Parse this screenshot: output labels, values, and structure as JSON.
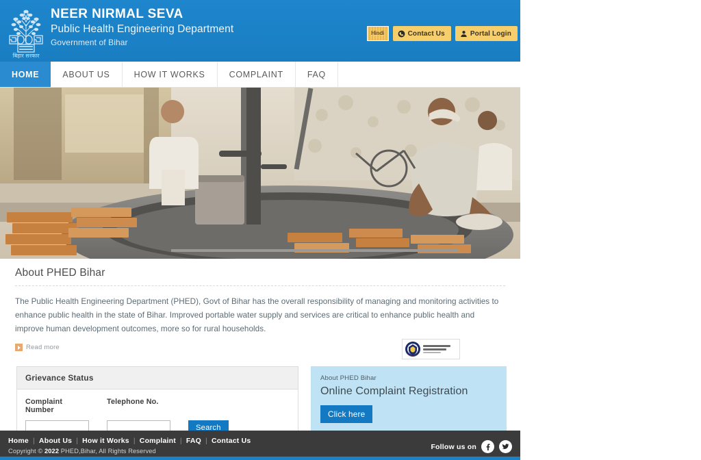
{
  "header": {
    "emblem_name": "bihar-government-emblem",
    "emblem_caption": "बिहार सरकार",
    "title": "NEER NIRMAL SEVA",
    "subtitle": "Public Health Engineering Department",
    "subtitle2": "Government of Bihar",
    "buttons": {
      "language_label": "Hindi",
      "contact_label": "Contact Us",
      "contact_icon": "phone-icon",
      "login_label": "Portal Login",
      "login_icon": "user-icon"
    }
  },
  "nav": {
    "items": [
      {
        "label": "HOME",
        "active": true
      },
      {
        "label": "ABOUT US",
        "active": false
      },
      {
        "label": "HOW IT WORKS",
        "active": false
      },
      {
        "label": "COMPLAINT",
        "active": false
      },
      {
        "label": "FAQ",
        "active": false
      }
    ]
  },
  "hero": {
    "alt": "Workers constructing a hand pump platform with bricks"
  },
  "about": {
    "heading": "About PHED Bihar",
    "body": "The Public Health Engineering Department (PHED), Govt of Bihar has the overall responsibility of managing and monitoring activities to enhance public health in the state of Bihar. Improved portable water supply and services are critical to enhance public health and improve human development outcomes, more so for rural households.",
    "read_more": "Read more",
    "read_more_icon": "play-arrow-icon",
    "badge_name": "partner-logo-badge"
  },
  "grievance": {
    "title": "Grievance Status",
    "complaint_label": "Complaint Number",
    "complaint_value": "",
    "complaint_placeholder": "",
    "telephone_label": "Telephone No.",
    "telephone_value": "",
    "telephone_placeholder": "",
    "search_label": "Search"
  },
  "registration": {
    "eyebrow": "About PHED Bihar",
    "title": "Online Complaint Registration",
    "button_label": "Click here"
  },
  "footer": {
    "links": [
      "Home",
      "About Us",
      "How it Works",
      "Complaint",
      "FAQ",
      "Contact Us"
    ],
    "separator": "|",
    "copyright_prefix": "Copyright © ",
    "copyright_year": "2022",
    "copyright_suffix": " PHED,Bihar, All Rights Reserved",
    "follow_label": "Follow us on",
    "social": [
      "facebook-icon",
      "twitter-icon"
    ]
  },
  "colors": {
    "header_blue": "#1b82c8",
    "accent_blue": "#1379c3",
    "button_yellow": "#f6cf6c",
    "panel_light_blue": "#bfe2f5",
    "footer_dark": "#3b3b3b"
  }
}
